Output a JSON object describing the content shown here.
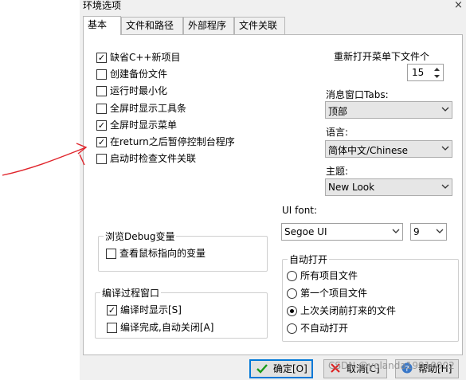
{
  "window": {
    "title": "环境选项",
    "close_glyph": "×"
  },
  "tabs": [
    {
      "label": "基本",
      "active": true
    },
    {
      "label": "文件和路径",
      "active": false
    },
    {
      "label": "外部程序",
      "active": false
    },
    {
      "label": "文件关联",
      "active": false
    }
  ],
  "options": [
    {
      "label": "缺省C++新项目",
      "checked": true
    },
    {
      "label": "创建备份文件",
      "checked": false
    },
    {
      "label": "运行时最小化",
      "checked": false
    },
    {
      "label": "全屏时显示工具条",
      "checked": false
    },
    {
      "label": "全屏时显示菜单",
      "checked": true
    },
    {
      "label": "在return之后暂停控制台程序",
      "checked": true
    },
    {
      "label": "启动时检查文件关联",
      "checked": false
    }
  ],
  "recent_menu": {
    "label": "重新打开菜单下文件个",
    "value": "15"
  },
  "msg_tabs": {
    "label": "消息窗口Tabs:",
    "value": "顶部"
  },
  "language": {
    "label": "语言:",
    "value": "简体中文/Chinese"
  },
  "theme": {
    "label": "主题:",
    "value": "New Look"
  },
  "ui_font": {
    "label": "UI font:",
    "font": "Segoe UI",
    "size": "9"
  },
  "debug_group": {
    "title": "浏览Debug变量",
    "watch_mouse": {
      "label": "查看鼠标指向的变量",
      "checked": false
    }
  },
  "compile_group": {
    "title": "编译过程窗口",
    "show_on_compile": {
      "label": "编译时显示[S]",
      "checked": true
    },
    "auto_close": {
      "label": "编译完成,自动关闭[A]",
      "checked": false
    }
  },
  "auto_open": {
    "title": "自动打开",
    "options": [
      {
        "label": "所有项目文件",
        "selected": false
      },
      {
        "label": "第一个项目文件",
        "selected": false
      },
      {
        "label": "上次关闭前打来的文件",
        "selected": true
      },
      {
        "label": "不自动打开",
        "selected": false
      }
    ]
  },
  "buttons": {
    "ok": "确定[O]",
    "cancel": "取消[C]",
    "help": "帮助[H]"
  },
  "watermark": "CSDN @yolanda19910002",
  "colors": {
    "accent": "#0078d7",
    "annotation": "#e0242b",
    "check_ok": "#1a9b1a",
    "cancel_red": "#d22"
  }
}
